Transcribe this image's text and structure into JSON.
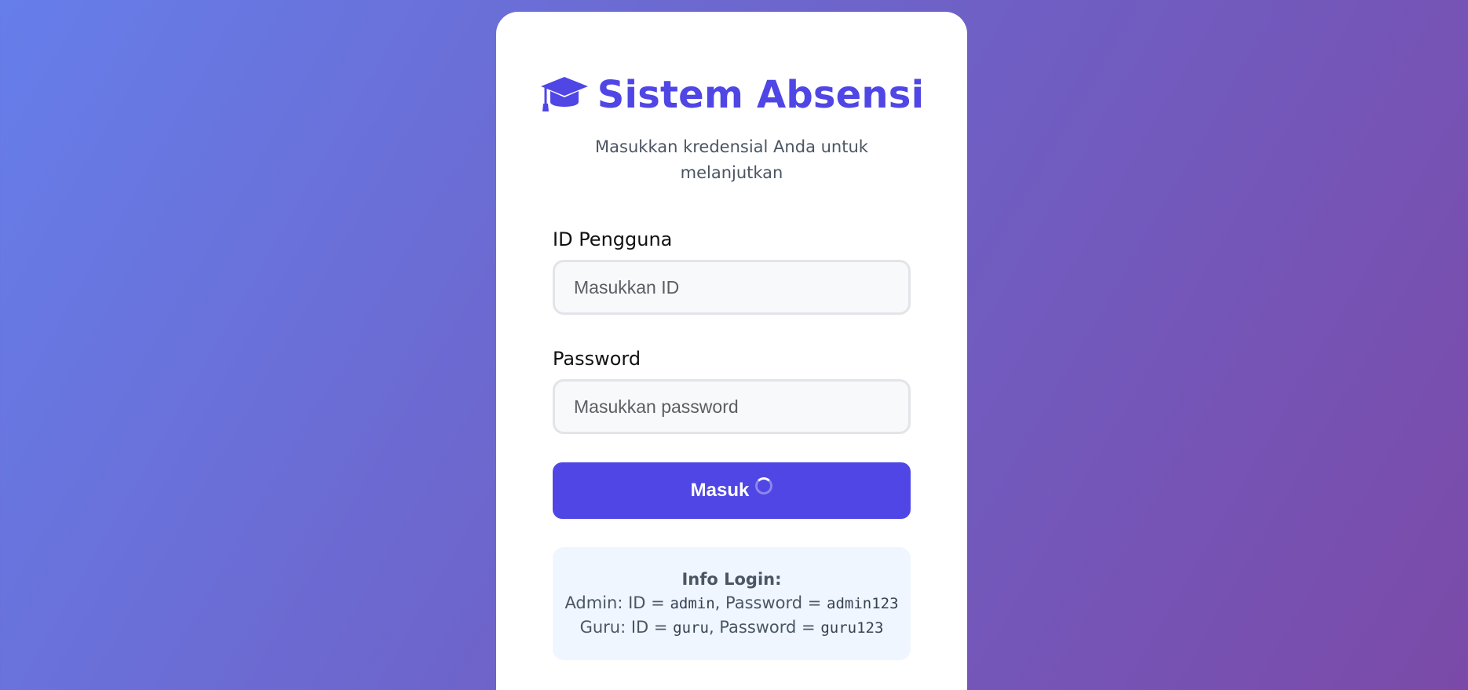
{
  "brand": {
    "title": "Sistem Absensi",
    "icon": "graduation-cap-icon",
    "accent": "#4f46e5"
  },
  "subtitle": "Masukkan kredensial Anda untuk melanjutkan",
  "form": {
    "id_label": "ID Pengguna",
    "id_placeholder": "Masukkan ID",
    "password_label": "Password",
    "password_placeholder": "Masukkan password",
    "submit_label": "Masuk",
    "submit_loading": true
  },
  "info": {
    "title": "Info Login:",
    "admin": {
      "prefix": "Admin: ID = ",
      "id": "admin",
      "mid": ", Password = ",
      "password": "admin123"
    },
    "guru": {
      "prefix": "Guru: ID = ",
      "id": "guru",
      "mid": ", Password = ",
      "password": "guru123"
    }
  },
  "colors": {
    "background_start": "#667eea",
    "background_end": "#7b4aa8",
    "button": "#4f46e5",
    "info_bg": "#eff6ff"
  }
}
